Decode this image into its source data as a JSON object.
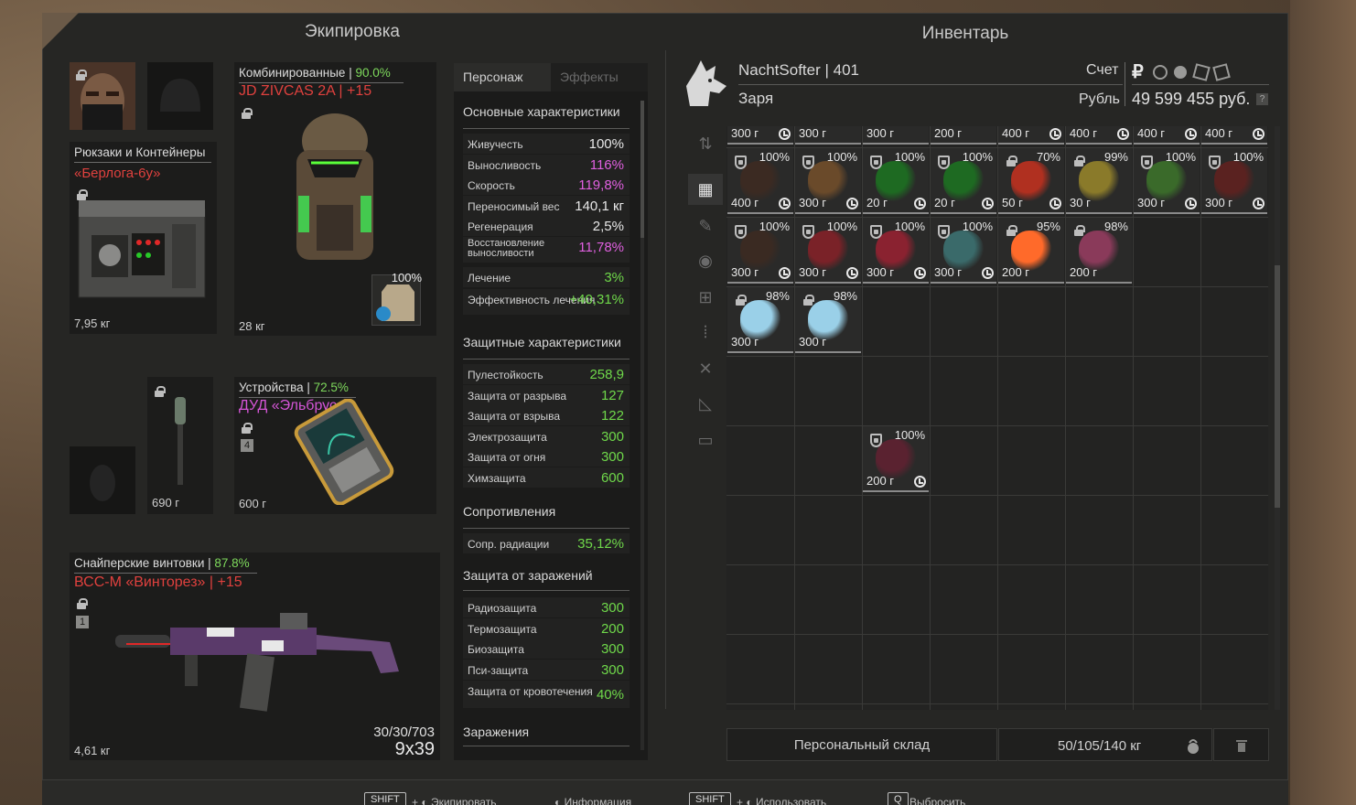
{
  "equipment_panel": {
    "title": "Экипировка",
    "armor": {
      "category": "Комбинированные",
      "percent": "90.0%",
      "name": "JD ZIVCAS 2A",
      "upgrade": "+15",
      "weight": "28 кг",
      "plate_percent": "100%"
    },
    "backpack": {
      "category": "Рюкзаки и Контейнеры",
      "name": "«Берлога-6у»",
      "weight": "7,95 кг"
    },
    "grenade": {
      "weight": "690 г"
    },
    "device": {
      "category": "Устройства",
      "percent": "72.5%",
      "name": "ДУД «Эльбрус»",
      "badge": "4",
      "weight": "600 г"
    },
    "weapon": {
      "category": "Снайперские винтовки",
      "percent": "87.8%",
      "name": "ВСС-М «Винторез»",
      "upgrade": "+15",
      "badge": "1",
      "weight": "4,61 кг",
      "ammo": "30/30/703",
      "caliber": "9x39"
    }
  },
  "stats": {
    "tabs": [
      "Персонаж",
      "Эффекты"
    ],
    "main_title": "Основные характеристики",
    "main": [
      {
        "k": "Живучесть",
        "v": "100%",
        "c": "w"
      },
      {
        "k": "Выносливость",
        "v": "116%",
        "c": "m"
      },
      {
        "k": "Скорость",
        "v": "119,8%",
        "c": "m"
      },
      {
        "k": "Переносимый вес",
        "v": "140,1 кг",
        "c": "w"
      },
      {
        "k": "Регенерация",
        "v": "2,5%",
        "c": "w"
      },
      {
        "k": "Восстановление выносливости",
        "v": "11,78%",
        "c": "m"
      },
      {
        "k": "Лечение",
        "v": "3%",
        "c": "g"
      },
      {
        "k": "Эффективность лечения",
        "v": "+40,31%",
        "c": "g"
      }
    ],
    "prot_title": "Защитные характеристики",
    "prot": [
      {
        "k": "Пулестойкость",
        "v": "258,9"
      },
      {
        "k": "Защита от разрыва",
        "v": "127"
      },
      {
        "k": "Защита от взрыва",
        "v": "122"
      },
      {
        "k": "Электрозащита",
        "v": "300"
      },
      {
        "k": "Защита от огня",
        "v": "300"
      },
      {
        "k": "Химзащита",
        "v": "600"
      }
    ],
    "res_title": "Сопротивления",
    "res": [
      {
        "k": "Сопр. радиации",
        "v": "35,12%"
      }
    ],
    "inf_title": "Защита от заражений",
    "inf": [
      {
        "k": "Радиозащита",
        "v": "300"
      },
      {
        "k": "Термозащита",
        "v": "200"
      },
      {
        "k": "Биозащита",
        "v": "300"
      },
      {
        "k": "Пси-защита",
        "v": "300"
      },
      {
        "k": "Защита от кровотечения",
        "v": "40%"
      }
    ],
    "zar_title": "Заражения"
  },
  "inventory": {
    "title": "Инвентарь",
    "player": "NachtSofter | 401",
    "faction": "Заря",
    "account_label": "Счет",
    "currency_label": "Рубль",
    "balance": "49 599 455 руб.",
    "help": "?",
    "currency_symbol": "₽",
    "top_row": [
      "300 г",
      "300 г",
      "300 г",
      "200 г",
      "400 г",
      "400 г",
      "400 г",
      "400 г"
    ],
    "items": [
      {
        "p": "100%",
        "w": "400 г",
        "col": 0,
        "row": 0,
        "color": "#3b2a22",
        "icon": "shield",
        "clock": true
      },
      {
        "p": "100%",
        "w": "300 г",
        "col": 1,
        "row": 0,
        "color": "#6a4a2a",
        "icon": "shield",
        "clock": true
      },
      {
        "p": "100%",
        "w": "20 г",
        "col": 2,
        "row": 0,
        "color": "#1e6a22",
        "icon": "shield",
        "clock": true
      },
      {
        "p": "100%",
        "w": "20 г",
        "col": 3,
        "row": 0,
        "color": "#1e6a22",
        "icon": "shield",
        "clock": true
      },
      {
        "p": "70%",
        "w": "50 г",
        "col": 4,
        "row": 0,
        "color": "#b03020",
        "icon": "lock",
        "clock": true
      },
      {
        "p": "99%",
        "w": "30 г",
        "col": 5,
        "row": 0,
        "color": "#8a7a2a",
        "icon": "lock",
        "clock": false
      },
      {
        "p": "100%",
        "w": "300 г",
        "col": 6,
        "row": 0,
        "color": "#3a6a2a",
        "icon": "shield",
        "clock": true
      },
      {
        "p": "100%",
        "w": "300 г",
        "col": 7,
        "row": 0,
        "color": "#5a2220",
        "icon": "shield",
        "clock": true
      },
      {
        "p": "100%",
        "w": "300 г",
        "col": 0,
        "row": 1,
        "color": "#3a2a22",
        "icon": "shield",
        "clock": true
      },
      {
        "p": "100%",
        "w": "300 г",
        "col": 1,
        "row": 1,
        "color": "#7a2228",
        "icon": "shield",
        "clock": true
      },
      {
        "p": "100%",
        "w": "300 г",
        "col": 2,
        "row": 1,
        "color": "#8a2230",
        "icon": "shield",
        "clock": true
      },
      {
        "p": "100%",
        "w": "300 г",
        "col": 3,
        "row": 1,
        "color": "#3a6a6a",
        "icon": "shield",
        "clock": true
      },
      {
        "p": "95%",
        "w": "200 г",
        "col": 4,
        "row": 1,
        "color": "#ff6a2a",
        "icon": "lock",
        "clock": false
      },
      {
        "p": "98%",
        "w": "200 г",
        "col": 5,
        "row": 1,
        "color": "#8a3a5a",
        "icon": "lock",
        "clock": false
      },
      {
        "p": "98%",
        "w": "300 г",
        "col": 0,
        "row": 2,
        "color": "#9ad0e8",
        "icon": "lock",
        "clock": false
      },
      {
        "p": "98%",
        "w": "300 г",
        "col": 1,
        "row": 2,
        "color": "#9ad0e8",
        "icon": "lock",
        "clock": false
      },
      {
        "p": "100%",
        "w": "200 г",
        "col": 2,
        "row": 4,
        "color": "#5a2230",
        "icon": "shield",
        "clock": true
      }
    ],
    "storage_button": "Персональный склад",
    "weight": "50/105/140 кг"
  },
  "footer": [
    {
      "key": "SHIFT",
      "text": "Экипировать"
    },
    {
      "key": "",
      "text": "Информация"
    },
    {
      "key": "SHIFT",
      "text": "Использовать"
    },
    {
      "key": "Q",
      "text": "Выбросить"
    }
  ]
}
